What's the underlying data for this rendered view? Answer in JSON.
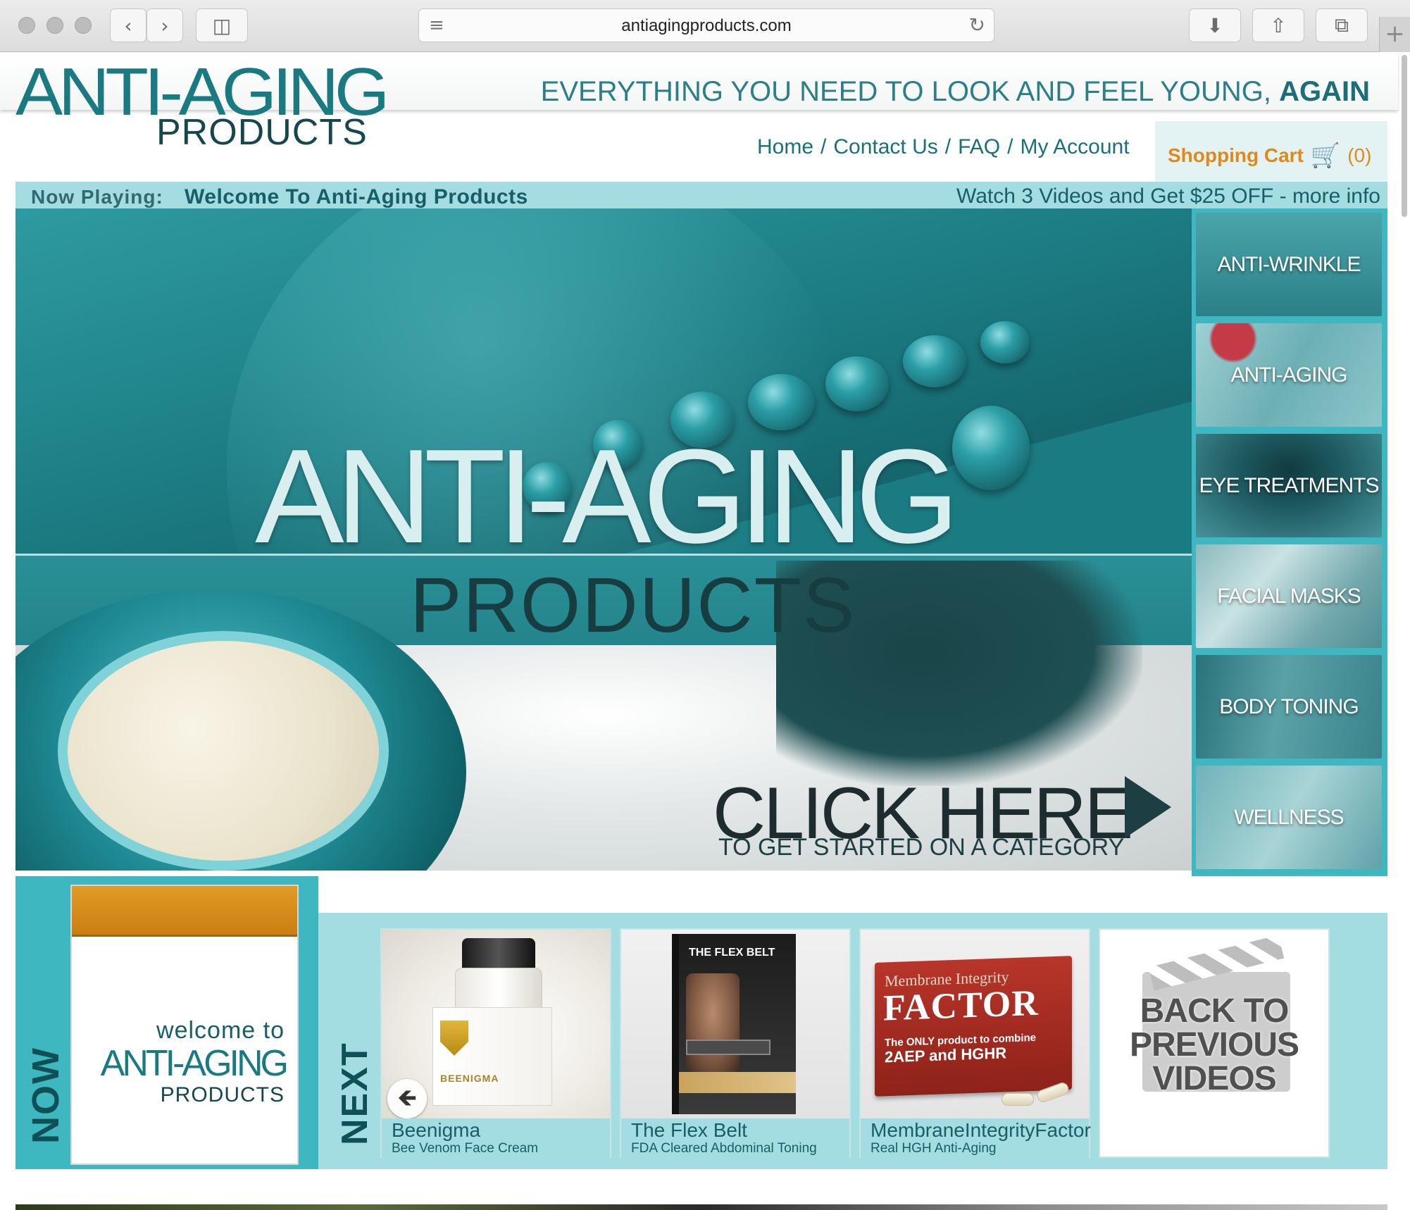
{
  "browser": {
    "url": "antiagingproducts.com",
    "icons": [
      "back-icon",
      "forward-icon",
      "sidebar-icon",
      "reader-icon",
      "reload-icon",
      "download-icon",
      "share-icon",
      "tabs-icon",
      "new-tab-icon"
    ]
  },
  "header": {
    "logo_line1": "ANTI-AGING",
    "logo_line2": "PRODUCTS",
    "tagline_main": "EVERYTHING YOU NEED TO LOOK AND FEEL YOUNG,",
    "tagline_emphasis": "AGAIN"
  },
  "nav": {
    "items": [
      "Home",
      "Contact Us",
      "FAQ",
      "My Account"
    ],
    "separator": "/",
    "cart_label": "Shopping Cart",
    "cart_count": "(0)"
  },
  "now_playing": {
    "label": "Now Playing:",
    "title": "Welcome To Anti-Aging Products",
    "promo": "Watch 3 Videos and Get $25 OFF - more info"
  },
  "hero": {
    "title": "ANTI-AGING",
    "subtitle": "PRODUCTS",
    "cta": "CLICK HERE",
    "cta_sub": "TO GET STARTED ON A CATEGORY"
  },
  "categories": [
    "ANTI-WRINKLE",
    "ANTI-AGING",
    "EYE TREATMENTS",
    "FACIAL MASKS",
    "BODY TONING",
    "WELLNESS"
  ],
  "playlist": {
    "now_label": "NOW",
    "next_label": "NEXT",
    "now_card": {
      "welcome": "welcome to",
      "logo1": "ANTI-AGING",
      "logo2": "PRODUCTS"
    },
    "videos": [
      {
        "name": "Beenigma",
        "desc": "Bee Venom Face Cream",
        "art_label": "BEENIGMA"
      },
      {
        "name": "The Flex Belt",
        "desc": "FDA Cleared Abdominal Toning",
        "art_label": "THE FLEX BELT"
      },
      {
        "name": "MembraneIntegrityFactor",
        "desc": "Real HGH Anti-Aging",
        "art_line1": "Membrane Integrity",
        "art_line2": "FACTOR",
        "art_line3": "The ONLY product to combine",
        "art_line4": "2AEP and HGHR"
      }
    ],
    "back_tile": {
      "line1": "BACK TO",
      "line2": "PREVIOUS",
      "line3": "VIDEOS"
    }
  },
  "colors": {
    "brand_teal": "#1a7a82",
    "accent_orange": "#e0891a",
    "light_teal": "#a4dde1",
    "mid_teal": "#3fb7c0"
  }
}
